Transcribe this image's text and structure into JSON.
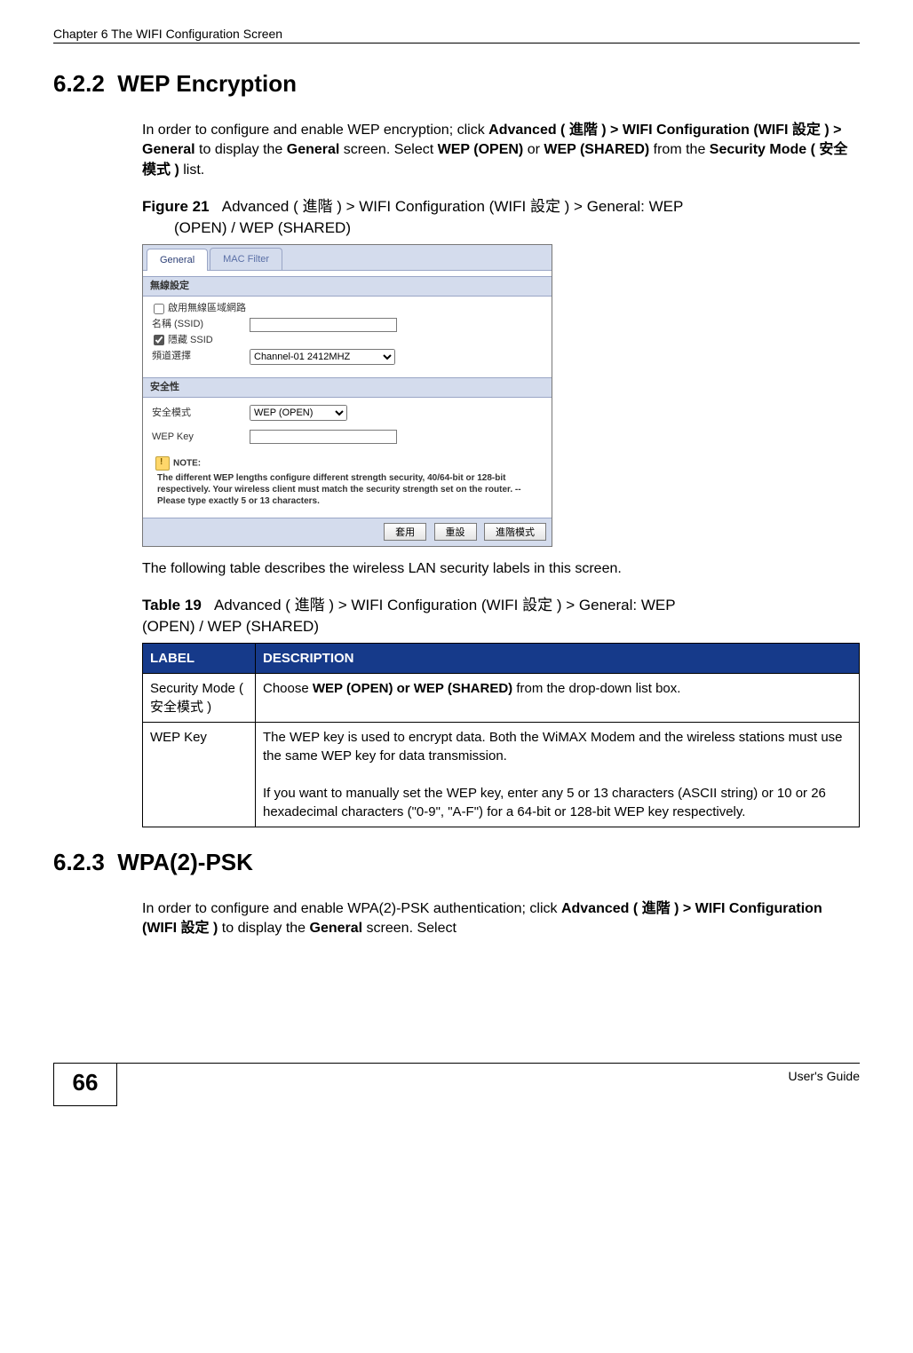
{
  "running_head": "Chapter 6 The WIFI Configuration Screen",
  "section_622": {
    "number": "6.2.2",
    "title": "WEP Encryption",
    "para_parts": [
      "In order to configure and enable WEP encryption; click ",
      "Advanced ( 進階 ) > WIFI Configuration (WIFI 設定 ) > General",
      " to display the ",
      "General",
      " screen. Select ",
      "WEP (OPEN)",
      " or ",
      "WEP (SHARED)",
      " from the ",
      "Security Mode ( 安全模式 )",
      " list."
    ]
  },
  "figure21": {
    "label": "Figure 21",
    "caption_line1": "Advanced ( 進階 ) > WIFI Configuration (WIFI 設定 ) > General: WEP",
    "caption_line2": "(OPEN) / WEP (SHARED)"
  },
  "screenshot": {
    "tab_general": "General",
    "tab_macfilter": "MAC Filter",
    "sec_wireless": "無線設定",
    "chk_enable": "啟用無線區域網路",
    "lbl_ssid": "名稱 (SSID)",
    "chk_hide": "隱藏 SSID",
    "lbl_channel": "頻道選擇",
    "channel_value": "Channel-01 2412MHZ",
    "sec_security": "安全性",
    "lbl_secmode": "安全模式",
    "secmode_value": "WEP (OPEN)",
    "lbl_wepkey": "WEP Key",
    "note_label": "NOTE:",
    "note_text": "The different WEP lengths configure different strength security, 40/64-bit or 128-bit respectively. Your wireless client must match the security strength set on the router. --Please type exactly 5 or 13 characters.",
    "btn_apply": "套用",
    "btn_reset": "重設",
    "btn_advanced": "進階模式"
  },
  "table19_intro": "The following table describes the wireless LAN security labels in this screen.",
  "table19": {
    "label": "Table 19",
    "caption_line1": "Advanced ( 進階 ) > WIFI Configuration (WIFI 設定 ) > General: WEP",
    "caption_line2": "(OPEN) / WEP (SHARED)",
    "head_label": "LABEL",
    "head_desc": "DESCRIPTION",
    "rows": [
      {
        "label": "Security Mode ( 安全模式 )",
        "desc_pre": "Choose ",
        "desc_bold": "WEP (OPEN) or WEP (SHARED)",
        "desc_post": " from the drop-down list box."
      },
      {
        "label": "WEP Key",
        "desc_p1": "The WEP key is used to encrypt data. Both the WiMAX Modem and the wireless stations must use the same WEP key for data transmission.",
        "desc_p2": "If you want to manually set the WEP key, enter any 5 or 13 characters (ASCII string) or 10 or 26 hexadecimal characters (\"0-9\", \"A-F\") for a 64-bit or 128-bit WEP key respectively."
      }
    ]
  },
  "section_623": {
    "number": "6.2.3",
    "title": "WPA(2)-PSK",
    "para_parts": [
      "In order to configure and enable WPA(2)-PSK authentication; click ",
      "Advanced ( 進階 ) > WIFI Configuration (WIFI 設定 )",
      " to display the ",
      "General",
      " screen. Select"
    ]
  },
  "footer": {
    "page": "66",
    "guide": "User's Guide"
  }
}
